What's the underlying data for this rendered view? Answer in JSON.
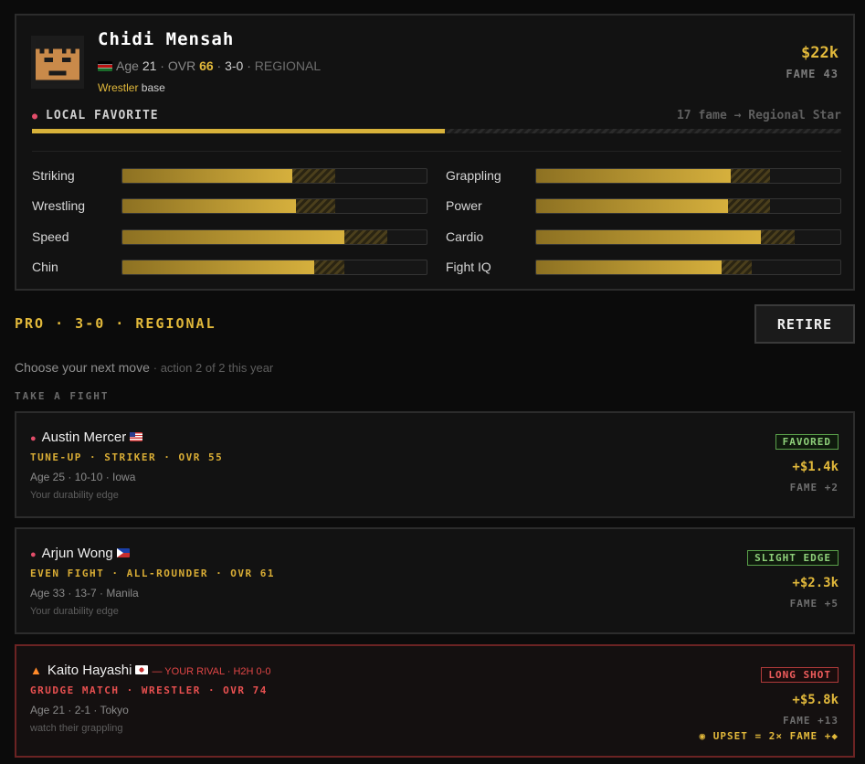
{
  "fighter": {
    "name": "Chidi Mensah",
    "age_label": "Age",
    "age": "21",
    "ovr_label": "OVR",
    "ovr": "66",
    "record": "3-0",
    "tier": "REGIONAL",
    "archetype": "Wrestler",
    "archetype_suffix": "base",
    "purse": "$22k",
    "fame": "FAME 43",
    "nationality_icon": "kenya-flag-icon"
  },
  "status": {
    "label": "LOCAL FAVORITE",
    "next": "17 fame → Regional Star",
    "progress": 0.51
  },
  "stats": [
    {
      "label": "Striking",
      "value": 0.56,
      "potential": 0.7
    },
    {
      "label": "Grappling",
      "value": 0.64,
      "potential": 0.77
    },
    {
      "label": "Wrestling",
      "value": 0.57,
      "potential": 0.7
    },
    {
      "label": "Power",
      "value": 0.63,
      "potential": 0.77
    },
    {
      "label": "Speed",
      "value": 0.73,
      "potential": 0.87
    },
    {
      "label": "Cardio",
      "value": 0.74,
      "potential": 0.85
    },
    {
      "label": "Chin",
      "value": 0.63,
      "potential": 0.73
    },
    {
      "label": "Fight IQ",
      "value": 0.61,
      "potential": 0.71
    }
  ],
  "career": {
    "heading": "PRO · 3-0 · REGIONAL",
    "retire_label": "RETIRE",
    "prompt": "Choose your next move",
    "prompt_sub": "· action 2 of 2 this year",
    "section": "TAKE A FIGHT"
  },
  "fights": [
    {
      "name": "Austin Mercer",
      "flag": "us-flag-icon",
      "icon": "boxing-glove-icon",
      "tags": "TUNE-UP · STRIKER · OVR 55",
      "sub": "Age 25 · 10-10 · Iowa",
      "note": "Your durability edge",
      "badge": "FAVORED",
      "purse": "+$1.4k",
      "fame": "FAME +2"
    },
    {
      "name": "Arjun Wong",
      "flag": "philippines-flag-icon",
      "icon": "boxing-glove-icon",
      "tags": "EVEN FIGHT · ALL-ROUNDER · OVR 61",
      "sub": "Age 33 · 13-7 · Manila",
      "note": "Your durability edge",
      "badge": "SLIGHT EDGE",
      "purse": "+$2.3k",
      "fame": "FAME +5"
    },
    {
      "name": "Kaito Hayashi",
      "flag": "japan-flag-icon",
      "icon": "fire-icon",
      "rival_tag": "— YOUR RIVAL · H2H 0-0",
      "tags": "GRUDGE MATCH · WRESTLER · OVR 74",
      "sub": "Age 21 · 2-1 · Tokyo",
      "note": "watch their grappling",
      "badge": "LONG SHOT",
      "purse": "+$5.8k",
      "fame": "FAME +13",
      "upset": "UPSET = 2× FAME +",
      "upset_icon": "scream-emoji-icon",
      "upset_trail_icon": "flex-emoji-icon"
    }
  ],
  "colors": {
    "accent": "#e2b93b",
    "rival": "#e85050",
    "favored": "#8ed07a",
    "long_shot": "#ef5c5c"
  }
}
